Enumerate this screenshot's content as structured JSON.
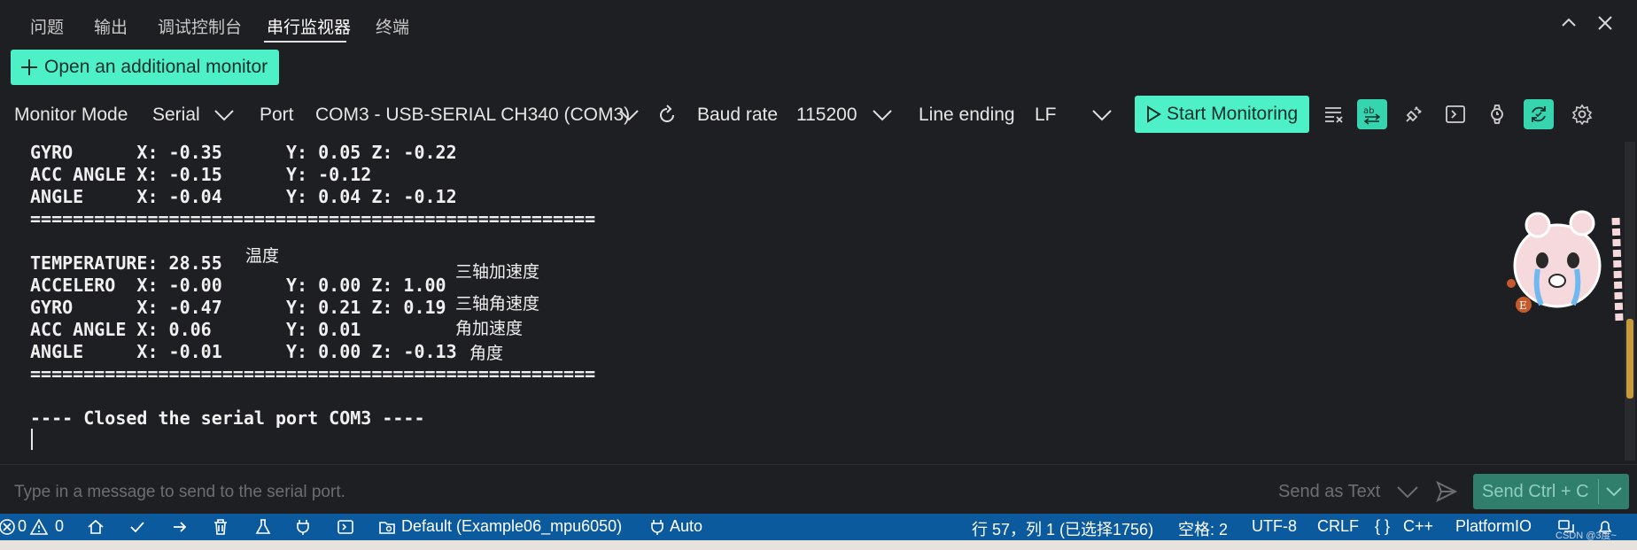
{
  "panel": {
    "tabs": [
      {
        "label": "问题"
      },
      {
        "label": "输出"
      },
      {
        "label": "调试控制台"
      },
      {
        "label": "串行监视器"
      },
      {
        "label": "终端"
      }
    ],
    "active_tab": "串行监视器"
  },
  "monitor": {
    "add_monitor_label": "Open an additional monitor",
    "mode_label": "Monitor Mode",
    "mode_value": "Serial",
    "port_label": "Port",
    "port_value": "COM3 - USB-SERIAL CH340 (COM3)",
    "baud_label": "Baud rate",
    "baud_value": "115200",
    "line_ending_label": "Line ending",
    "line_ending_value": "LF",
    "start_label": "Start Monitoring"
  },
  "output": {
    "lines": [
      "GYRO      X: -0.35      Y: 0.05 Z: -0.22",
      "ACC ANGLE X: -0.15      Y: -0.12",
      "ANGLE     X: -0.04      Y: 0.04 Z: -0.12",
      "=====================================================",
      "",
      "TEMPERATURE: 28.55",
      "ACCELERO  X: -0.00      Y: 0.00 Z: 1.00",
      "GYRO      X: -0.47      Y: 0.21 Z: 0.19",
      "ACC ANGLE X: 0.06       Y: 0.01",
      "ANGLE     X: -0.01      Y: 0.00 Z: -0.13",
      "=====================================================",
      "",
      "---- Closed the serial port COM3 ----"
    ],
    "annotations": {
      "temperature": "温度",
      "accel": "三轴加速度",
      "gyro": "三轴角速度",
      "acc_angle": "角加速度",
      "angle": "角度"
    }
  },
  "send": {
    "placeholder": "Type in a message to send to the serial port.",
    "mode_label": "Send as Text",
    "button_label": "Send Ctrl + C"
  },
  "statusbar": {
    "errors": "0",
    "warnings": "0",
    "env_label": "Default (Example06_mpu6050)",
    "port_auto": "Auto",
    "cursor_pos": "行 57，列 1 (已选择1756)",
    "indent": "空格: 2",
    "encoding": "UTF-8",
    "eol": "CRLF",
    "language": "C++",
    "platform": "PlatformIO"
  },
  "watermark": "CSDN @3度~",
  "colors": {
    "accent": "#4ef0c8",
    "accent_dark": "#37d4b0",
    "statusbar": "#0b5a9e",
    "background": "#1e1f22"
  }
}
